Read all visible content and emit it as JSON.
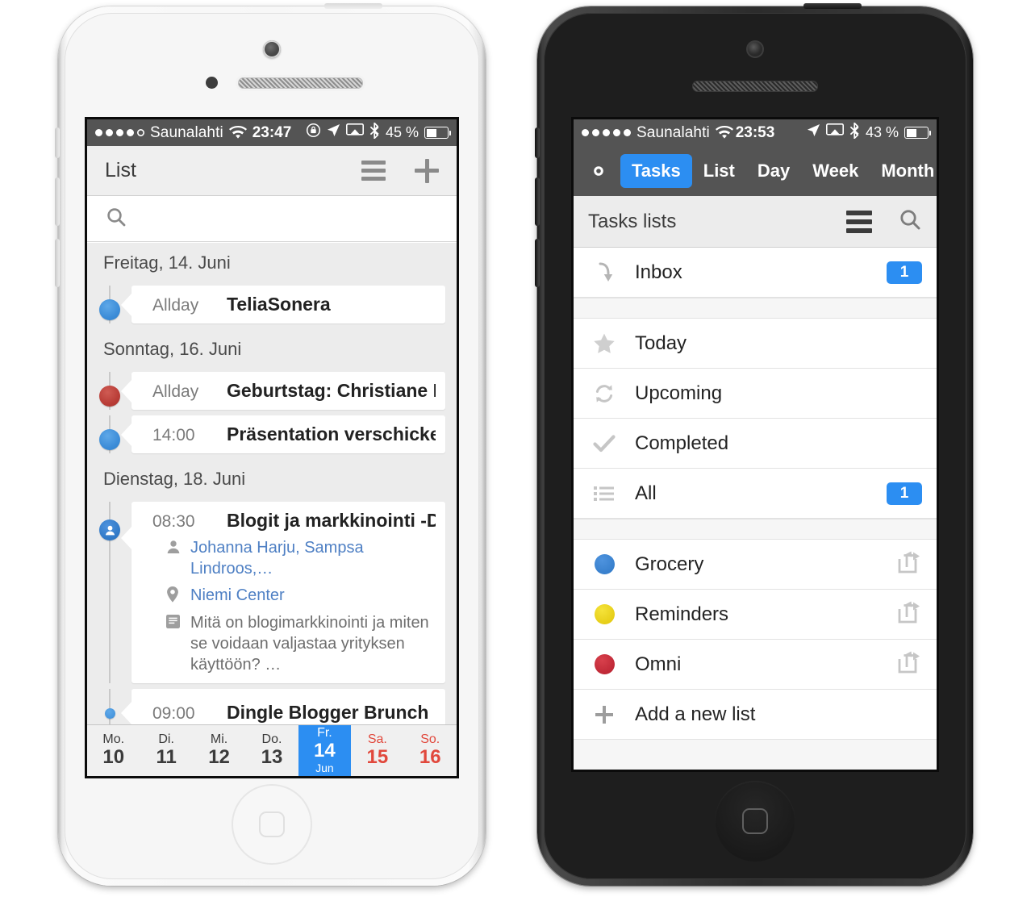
{
  "left_phone": {
    "device": "white-iphone",
    "status_bar": {
      "carrier": "Saunalahti",
      "signal_dots_filled": 4,
      "signal_dots_total": 5,
      "time": "23:47",
      "battery_percent": "45 %",
      "battery_level": 45,
      "icons": [
        "wifi-icon",
        "rotation-lock-icon",
        "location-arrow-icon",
        "airplay-icon",
        "bluetooth-icon",
        "battery-icon"
      ]
    },
    "nav": {
      "title": "List",
      "menu_icon": "hamburger-icon",
      "add_icon": "plus-icon"
    },
    "search": {
      "icon": "search-icon",
      "value": "",
      "placeholder": ""
    },
    "agenda": [
      {
        "day": "Freitag, 14. Juni",
        "events": [
          {
            "time": "Allday",
            "title": "TeliaSonera",
            "color": "#3d8dd8",
            "marker": "dot"
          }
        ]
      },
      {
        "day": "Sonntag, 16. Juni",
        "events": [
          {
            "time": "Allday",
            "title": "Geburtstag: Christiane Hohe…",
            "color": "#b93d37",
            "marker": "dot"
          },
          {
            "time": "14:00",
            "title": "Präsentation verschicken",
            "color": "#3d8dd8",
            "marker": "dot"
          }
        ]
      },
      {
        "day": "Dienstag, 18. Juni",
        "events": [
          {
            "time": "08:30",
            "title": "Blogit ja markkinointi -Dingl…",
            "color": "#2f78c6",
            "marker": "person",
            "attendees": "Johanna Harju, Sampsa Lindroos,…",
            "location": "Niemi Center",
            "note": "Mitä  on blogimarkkinointi ja miten\nse voidaan valjastaa yrityksen\nkäyttöön? …"
          },
          {
            "time": "09:00",
            "title": "Dingle Blogger Brunch",
            "color": "#3d8dd8",
            "marker": "dot-small"
          }
        ]
      }
    ],
    "weekstrip": [
      {
        "dow": "Mo.",
        "num": "10",
        "month": "",
        "state": "normal"
      },
      {
        "dow": "Di.",
        "num": "11",
        "month": "",
        "state": "normal"
      },
      {
        "dow": "Mi.",
        "num": "12",
        "month": "",
        "state": "normal"
      },
      {
        "dow": "Do.",
        "num": "13",
        "month": "",
        "state": "normal"
      },
      {
        "dow": "Fr.",
        "num": "14",
        "month": "Jun",
        "state": "today"
      },
      {
        "dow": "Sa.",
        "num": "15",
        "month": "",
        "state": "weekend"
      },
      {
        "dow": "So.",
        "num": "16",
        "month": "",
        "state": "weekend"
      }
    ]
  },
  "right_phone": {
    "device": "black-iphone",
    "status_bar": {
      "carrier": "Saunalahti",
      "signal_dots_filled": 5,
      "signal_dots_total": 5,
      "time": "23:53",
      "battery_percent": "43 %",
      "battery_level": 43,
      "icons": [
        "wifi-icon",
        "location-arrow-icon",
        "airplay-icon",
        "bluetooth-icon",
        "battery-icon"
      ]
    },
    "tabbar": {
      "settings_icon": "gear-icon",
      "calendar_icon": "calendar-31-icon",
      "tabs": [
        {
          "label": "Tasks",
          "active": true
        },
        {
          "label": "List",
          "active": false
        },
        {
          "label": "Day",
          "active": false
        },
        {
          "label": "Week",
          "active": false
        },
        {
          "label": "Month",
          "active": false
        }
      ],
      "active_color": "#2c8ef2"
    },
    "list_header": {
      "title": "Tasks lists",
      "menu_icon": "hamburger-icon",
      "search_icon": "search-icon"
    },
    "rows": [
      {
        "label": "Inbox",
        "icon": "inbox-arrow-icon",
        "badge": "1",
        "group": 1
      },
      {
        "label": "Today",
        "icon": "star-icon",
        "badge": "",
        "group": 2
      },
      {
        "label": "Upcoming",
        "icon": "refresh-loop-icon",
        "badge": "",
        "group": 2
      },
      {
        "label": "Completed",
        "icon": "checkmark-icon",
        "badge": "",
        "group": 2
      },
      {
        "label": "All",
        "icon": "list-bullets-icon",
        "badge": "1",
        "group": 2
      },
      {
        "label": "Grocery",
        "icon": "color-dot",
        "dot_color": "#2f78c6",
        "share_icon": "share-icon",
        "group": 3
      },
      {
        "label": "Reminders",
        "icon": "color-dot",
        "dot_color": "#edd315",
        "share_icon": "share-icon",
        "group": 3
      },
      {
        "label": "Omni",
        "icon": "color-dot",
        "dot_color": "#c32a38",
        "share_icon": "share-icon",
        "group": 3
      },
      {
        "label": "Add a new list",
        "icon": "plus-icon",
        "badge": "",
        "group": 3
      }
    ],
    "badge_color": "#2c8ef2"
  }
}
